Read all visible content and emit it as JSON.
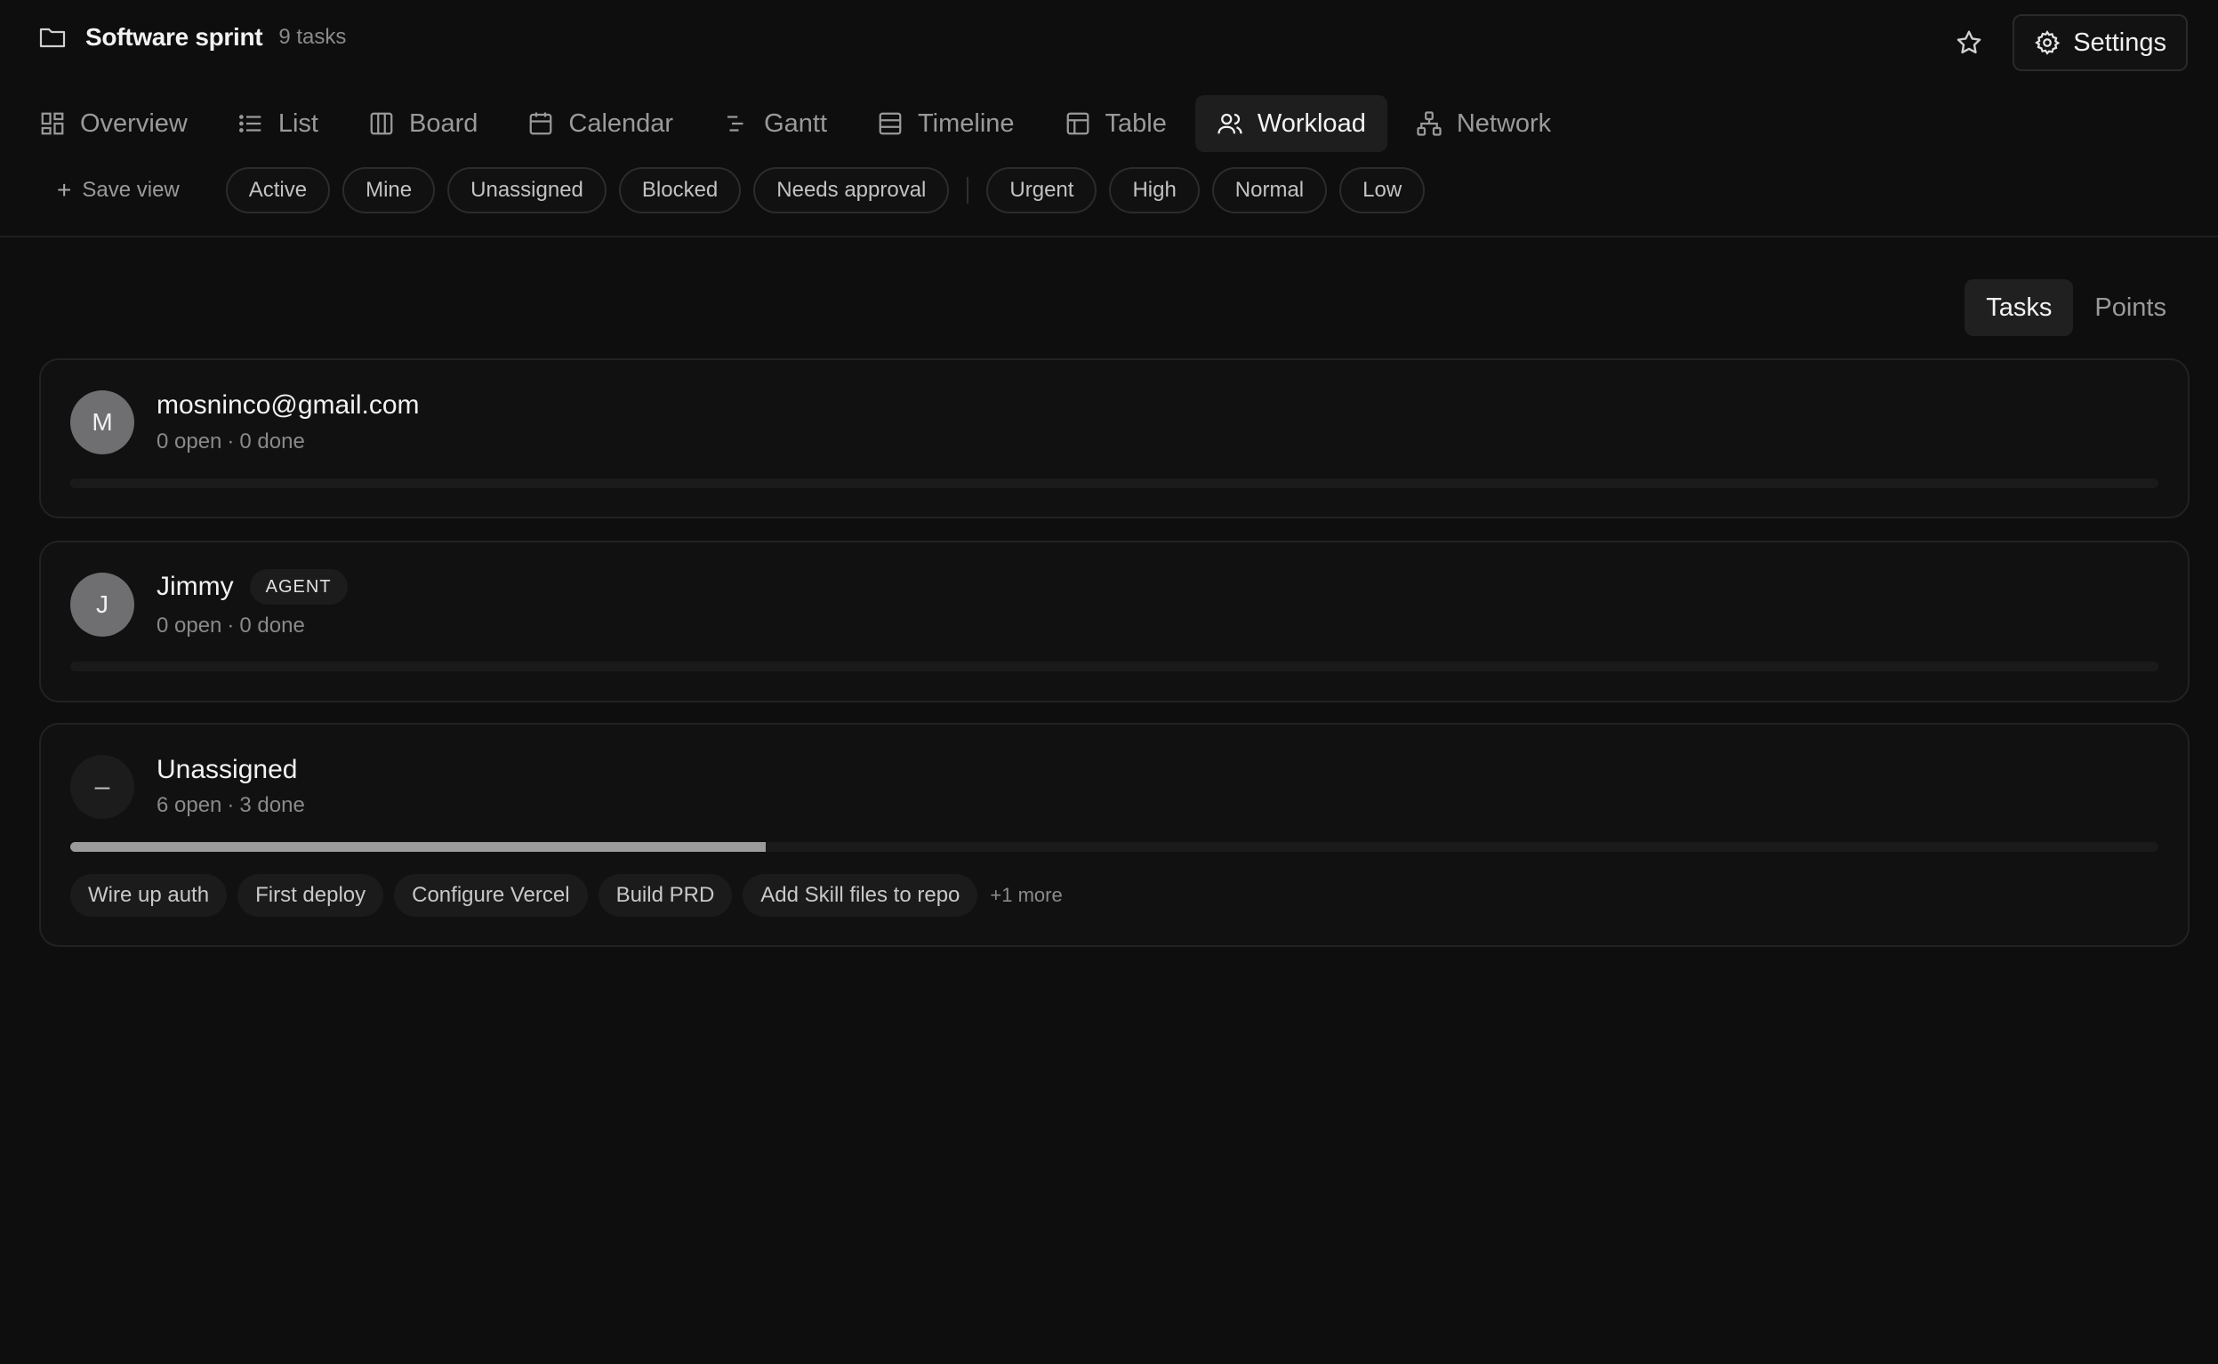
{
  "project": {
    "title": "Software sprint",
    "task_count": "9 tasks",
    "folder_icon": "folder-icon"
  },
  "header_actions": {
    "star_icon": "star-icon",
    "settings_label": "Settings",
    "settings_icon": "gear-icon"
  },
  "tabs": [
    {
      "label": "Overview",
      "icon": "overview-grid-icon",
      "active": false
    },
    {
      "label": "List",
      "icon": "list-icon",
      "active": false
    },
    {
      "label": "Board",
      "icon": "board-columns-icon",
      "active": false
    },
    {
      "label": "Calendar",
      "icon": "calendar-icon",
      "active": false
    },
    {
      "label": "Gantt",
      "icon": "gantt-icon",
      "active": false
    },
    {
      "label": "Timeline",
      "icon": "timeline-icon",
      "active": false
    },
    {
      "label": "Table",
      "icon": "table-icon",
      "active": false
    },
    {
      "label": "Workload",
      "icon": "users-icon",
      "active": true
    },
    {
      "label": "Network",
      "icon": "network-icon",
      "active": false
    }
  ],
  "filters": {
    "save_view": "Save view",
    "status": [
      "Active",
      "Mine",
      "Unassigned",
      "Blocked",
      "Needs approval"
    ],
    "priority": [
      "Urgent",
      "High",
      "Normal",
      "Low"
    ]
  },
  "metric_toggle": {
    "tasks": "Tasks",
    "points": "Points",
    "selected": "Tasks"
  },
  "assignees": [
    {
      "initial": "M",
      "name": "mosninco@gmail.com",
      "badge": "",
      "open": "0 open",
      "sep": "·",
      "done": "0 done",
      "progress": 0,
      "tasks": []
    },
    {
      "initial": "J",
      "name": "Jimmy",
      "badge": "AGENT",
      "open": "0 open",
      "sep": "·",
      "done": "0 done",
      "progress": 0,
      "tasks": []
    },
    {
      "initial": "–",
      "name": "Unassigned",
      "badge": "",
      "open": "6 open",
      "sep": "·",
      "done": "3 done",
      "progress": 0.333,
      "tasks": [
        "Wire up auth",
        "First deploy",
        "Configure Vercel",
        "Build PRD",
        "Add Skill files to repo"
      ],
      "more": "+1 more"
    }
  ],
  "colors": {
    "background": "#0e0e0e",
    "card": "#111111",
    "progress_fill": "#9b9b9b",
    "avatar": "#6f6f72"
  }
}
